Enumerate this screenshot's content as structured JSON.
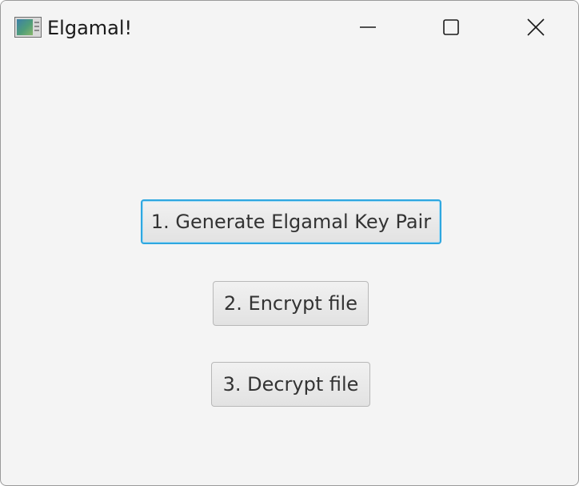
{
  "window": {
    "title": "Elgamal!",
    "icon": "java-app-icon",
    "controls": {
      "minimize_icon": "minimize-icon",
      "maximize_icon": "maximize-icon",
      "close_icon": "close-icon"
    }
  },
  "main": {
    "buttons": [
      {
        "label": "1. Generate Elgamal Key Pair",
        "focused": true
      },
      {
        "label": "2. Encrypt file",
        "focused": false
      },
      {
        "label": "3. Decrypt file",
        "focused": false
      }
    ]
  },
  "colors": {
    "background": "#f4f4f4",
    "focus_ring": "#2ea7e0",
    "button_text": "#333333"
  }
}
